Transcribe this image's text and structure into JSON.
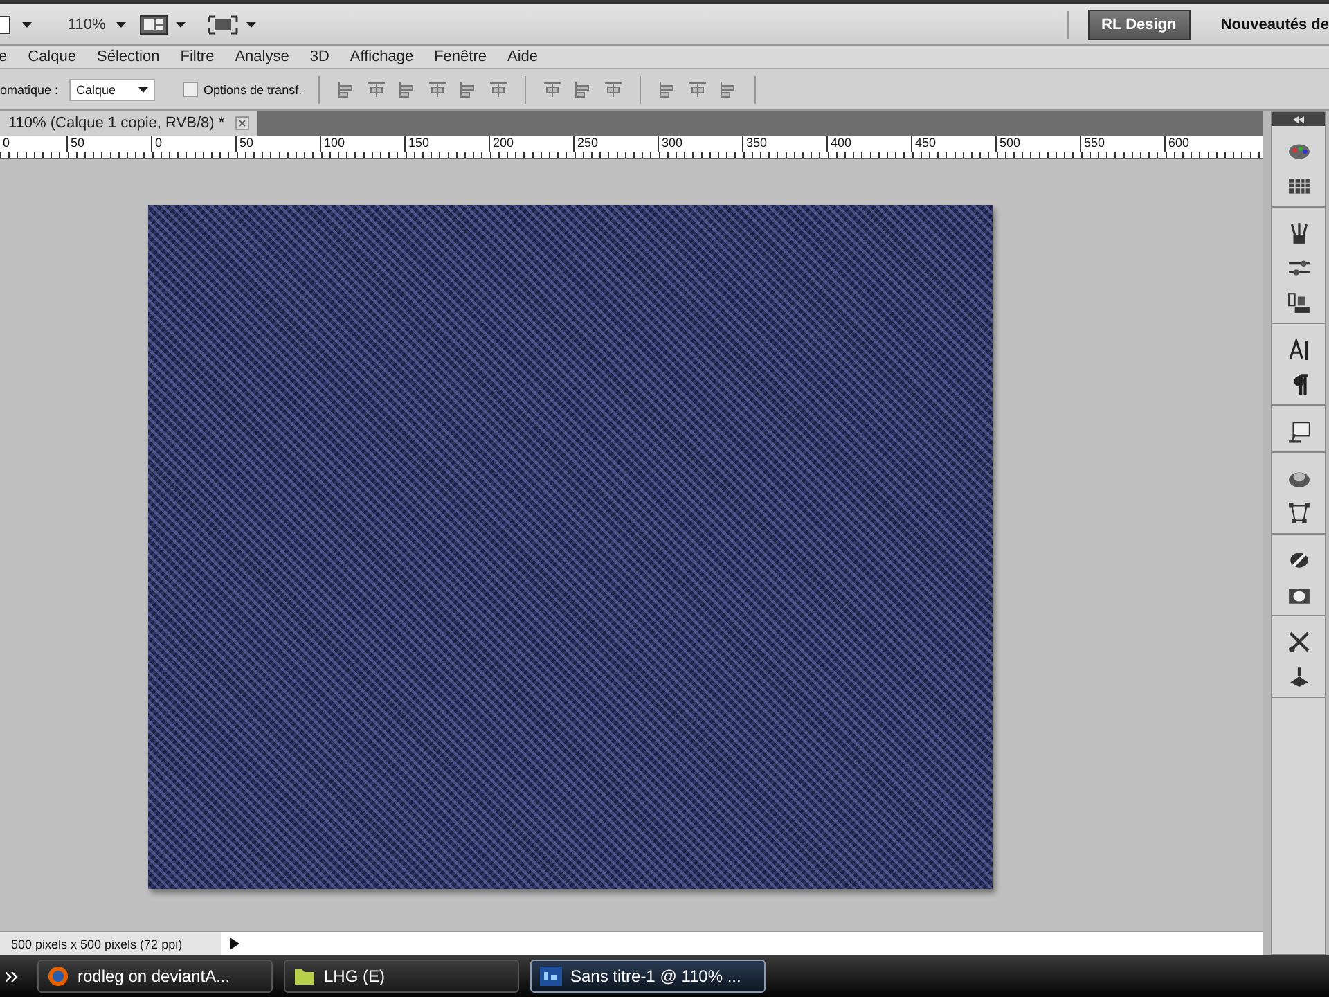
{
  "top_bar": {
    "zoom": "110%",
    "workspace_button": "RL Design",
    "whats_new": "Nouveautés de"
  },
  "menu": [
    "e",
    "Calque",
    "Sélection",
    "Filtre",
    "Analyse",
    "3D",
    "Affichage",
    "Fenêtre",
    "Aide"
  ],
  "options_bar": {
    "auto_select_label": "omatique :",
    "auto_select_value": "Calque",
    "transform_controls": {
      "label": "Options de transf.",
      "checked": false
    }
  },
  "document_tab": {
    "title": "110% (Calque 1 copie, RVB/8) *"
  },
  "ruler": {
    "labels": [
      "0",
      "50",
      "0",
      "50",
      "100",
      "150",
      "200",
      "250",
      "300",
      "350",
      "400",
      "450",
      "500",
      "550",
      "600"
    ]
  },
  "status_bar": {
    "doc_info": "500 pixels x 500 pixels (72 ppi)"
  },
  "taskbar": {
    "items": [
      {
        "label": "rodleg on deviantA...",
        "kind": "browser",
        "selected": false
      },
      {
        "label": "LHG (E)",
        "kind": "folder",
        "selected": false
      },
      {
        "label": "Sans titre-1 @ 110% ...",
        "kind": "photoshop",
        "selected": true
      }
    ]
  }
}
